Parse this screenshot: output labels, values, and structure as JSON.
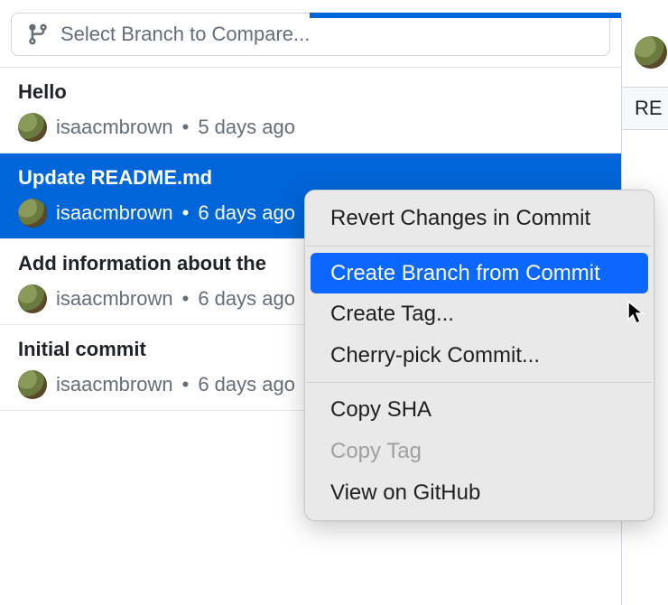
{
  "branchSelector": {
    "placeholder": "Select Branch to Compare..."
  },
  "commits": [
    {
      "title": "Hello",
      "author": "isaacmbrown",
      "time": "5 days ago",
      "selected": false
    },
    {
      "title": "Update README.md",
      "author": "isaacmbrown",
      "time": "6 days ago",
      "selected": true
    },
    {
      "title": "Add information about the",
      "author": "isaacmbrown",
      "time": "6 days ago",
      "selected": false
    },
    {
      "title": "Initial commit",
      "author": "isaacmbrown",
      "time": "6 days ago",
      "selected": false
    }
  ],
  "rightPanel": {
    "tabLabel": "RE"
  },
  "contextMenu": {
    "items": [
      {
        "label": "Revert Changes in Commit",
        "type": "item"
      },
      {
        "type": "sep"
      },
      {
        "label": "Create Branch from Commit",
        "type": "item",
        "highlighted": true
      },
      {
        "label": "Create Tag...",
        "type": "item"
      },
      {
        "label": "Cherry-pick Commit...",
        "type": "item"
      },
      {
        "type": "sep"
      },
      {
        "label": "Copy SHA",
        "type": "item"
      },
      {
        "label": "Copy Tag",
        "type": "item",
        "disabled": true
      },
      {
        "label": "View on GitHub",
        "type": "item"
      }
    ]
  }
}
